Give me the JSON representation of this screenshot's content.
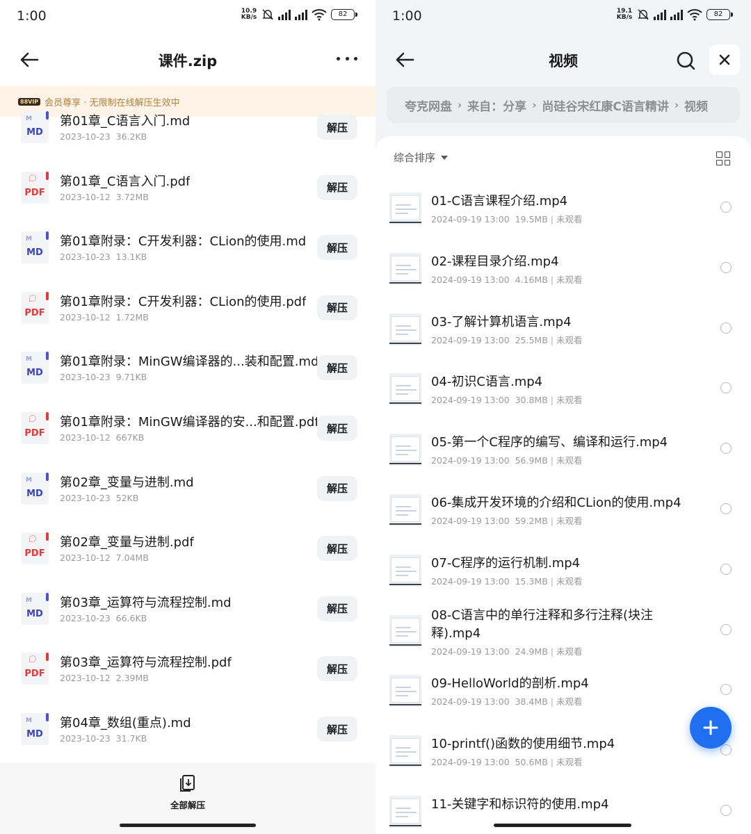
{
  "left": {
    "status": {
      "time": "1:00",
      "speed_value": "10.9",
      "speed_unit": "KB/s",
      "battery": "82"
    },
    "header": {
      "title": "课件.zip"
    },
    "banner": {
      "badge": "88VIP",
      "text": "会员尊享 · 无限制在线解压生效中"
    },
    "files": [
      {
        "name": "第01章_C语言入门.md",
        "date": "2023-10-23",
        "size": "36.2KB",
        "type": "MD",
        "action": "解压"
      },
      {
        "name": "第01章_C语言入门.pdf",
        "date": "2023-10-12",
        "size": "3.72MB",
        "type": "PDF",
        "action": "解压"
      },
      {
        "name": "第01章附录：C开发利器：CLion的使用.md",
        "date": "2023-10-23",
        "size": "13.1KB",
        "type": "MD",
        "action": "解压"
      },
      {
        "name": "第01章附录：C开发利器：CLion的使用.pdf",
        "date": "2023-10-12",
        "size": "1.72MB",
        "type": "PDF",
        "action": "解压"
      },
      {
        "name": "第01章附录：MinGW编译器的...装和配置.md",
        "date": "2023-10-23",
        "size": "9.71KB",
        "type": "MD",
        "action": "解压"
      },
      {
        "name": "第01章附录：MinGW编译器的安...和配置.pdf",
        "date": "2023-10-12",
        "size": "667KB",
        "type": "PDF",
        "action": "解压"
      },
      {
        "name": "第02章_变量与进制.md",
        "date": "2023-10-23",
        "size": "52KB",
        "type": "MD",
        "action": "解压"
      },
      {
        "name": "第02章_变量与进制.pdf",
        "date": "2023-10-12",
        "size": "7.04MB",
        "type": "PDF",
        "action": "解压"
      },
      {
        "name": "第03章_运算符与流程控制.md",
        "date": "2023-10-23",
        "size": "66.6KB",
        "type": "MD",
        "action": "解压"
      },
      {
        "name": "第03章_运算符与流程控制.pdf",
        "date": "2023-10-12",
        "size": "2.39MB",
        "type": "PDF",
        "action": "解压"
      },
      {
        "name": "第04章_数组(重点).md",
        "date": "2023-10-23",
        "size": "31.7KB",
        "type": "MD",
        "action": "解压"
      }
    ],
    "footer": {
      "unzip_all_label": "全部解压"
    }
  },
  "right": {
    "status": {
      "time": "1:00",
      "speed_value": "19.1",
      "speed_unit": "KB/s",
      "battery": "82"
    },
    "header": {
      "title": "视频"
    },
    "breadcrumb": [
      "夸克网盘",
      "来自：分享",
      "尚硅谷宋红康C语言精讲",
      "视频"
    ],
    "sort_label": "综合排序",
    "videos": [
      {
        "name": "01-C语言课程介绍.mp4",
        "datetime": "2024-09-19 13:00",
        "size": "19.5MB",
        "status": "未观看"
      },
      {
        "name": "02-课程目录介绍.mp4",
        "datetime": "2024-09-19 13:00",
        "size": "4.16MB",
        "status": "未观看"
      },
      {
        "name": "03-了解计算机语言.mp4",
        "datetime": "2024-09-19 13:00",
        "size": "25.5MB",
        "status": "未观看"
      },
      {
        "name": "04-初识C语言.mp4",
        "datetime": "2024-09-19 13:00",
        "size": "30.8MB",
        "status": "未观看"
      },
      {
        "name": "05-第一个C程序的编写、编译和运行.mp4",
        "datetime": "2024-09-19 13:00",
        "size": "56.9MB",
        "status": "未观看"
      },
      {
        "name": "06-集成开发环境的介绍和CLion的使用.mp4",
        "datetime": "2024-09-19 13:00",
        "size": "59.2MB",
        "status": "未观看"
      },
      {
        "name": "07-C程序的运行机制.mp4",
        "datetime": "2024-09-19 13:00",
        "size": "15.3MB",
        "status": "未观看"
      },
      {
        "name": "08-C语言中的单行注释和多行注释(块注释).mp4",
        "datetime": "2024-09-19 13:00",
        "size": "24.9MB",
        "status": "未观看"
      },
      {
        "name": "09-HelloWorld的剖析.mp4",
        "datetime": "2024-09-19 13:00",
        "size": "38.4MB",
        "status": "未观看"
      },
      {
        "name": "10-printf()函数的使用细节.mp4",
        "datetime": "2024-09-19 13:00",
        "size": "50.6MB",
        "status": "未观看"
      },
      {
        "name": "11-关键字和标识符的使用.mp4",
        "datetime": "",
        "size": "",
        "status": ""
      }
    ]
  },
  "icons": {
    "back": "arrow-left-icon",
    "more": "more-horizontal-icon",
    "search": "search-icon",
    "close": "close-icon",
    "grid": "grid-view-icon",
    "unzip_all": "unzip-all-icon",
    "add": "plus-icon"
  },
  "colors": {
    "accent": "#1f6ff0",
    "vip_text": "#b57f3a",
    "vip_bg": "#fdf3e6",
    "md": "#3b46b8",
    "pdf": "#e03b3b"
  }
}
